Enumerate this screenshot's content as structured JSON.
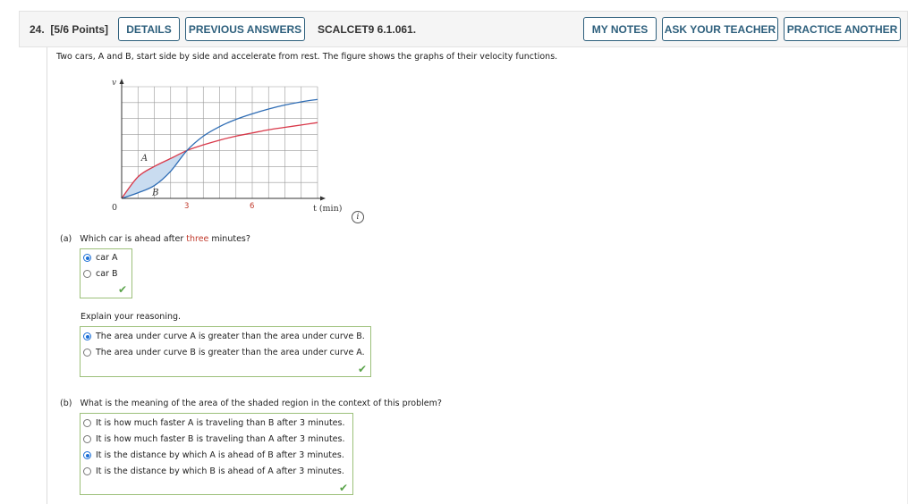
{
  "header": {
    "question_number": "24.",
    "points": "[5/6 Points]",
    "details_label": "DETAILS",
    "previous_answers_label": "PREVIOUS ANSWERS",
    "source": "SCALCET9 6.1.061.",
    "my_notes_label": "MY NOTES",
    "ask_teacher_label": "ASK YOUR TEACHER",
    "practice_another_label": "PRACTICE ANOTHER"
  },
  "intro": "Two cars, A and B, start side by side and accelerate from rest. The figure shows the graphs of their velocity functions.",
  "figure": {
    "info_icon": "i",
    "colors": {
      "curve_A": "#d9394a",
      "curve_B": "#2f6db5",
      "shade": "#c9dcf0",
      "tick_label": "#c0392b"
    }
  },
  "chart_data": {
    "type": "line",
    "title": "",
    "xlabel": "t (min)",
    "ylabel": "v",
    "origin_label": "0",
    "x_ticks": [
      3,
      6
    ],
    "xlim": [
      0,
      9
    ],
    "ylim": [
      0,
      7
    ],
    "grid": true,
    "grid_columns": 12,
    "grid_rows": 7,
    "series": [
      {
        "name": "A",
        "x": [
          0,
          0.75,
          1.5,
          2.25,
          3,
          3.75,
          4.5,
          5.25,
          6,
          6.75,
          7.5,
          8.25,
          9
        ],
        "y": [
          0,
          1.35,
          2.0,
          2.5,
          3.0,
          3.35,
          3.65,
          3.9,
          4.1,
          4.3,
          4.45,
          4.6,
          4.75
        ]
      },
      {
        "name": "B",
        "x": [
          0,
          0.75,
          1.5,
          2.25,
          3,
          3.75,
          4.5,
          5.25,
          6,
          6.75,
          7.5,
          8.25,
          9
        ],
        "y": [
          0,
          0.35,
          0.8,
          1.7,
          3.0,
          3.9,
          4.5,
          4.95,
          5.3,
          5.6,
          5.85,
          6.05,
          6.2
        ]
      }
    ],
    "annotations": [
      "A",
      "B"
    ],
    "shaded_region": "between A and B from t=0 to t=3"
  },
  "part_a": {
    "prefix": "(a)",
    "question_before": "Which car is ahead after ",
    "question_highlight": "three",
    "question_after": " minutes?",
    "options": [
      {
        "label": "car A",
        "selected": true
      },
      {
        "label": "car B",
        "selected": false
      }
    ],
    "correct": true,
    "explain_label": "Explain your reasoning.",
    "reason_options": [
      {
        "label": "The area under curve A is greater than the area under curve B.",
        "selected": true
      },
      {
        "label": "The area under curve B is greater than the area under curve A.",
        "selected": false
      }
    ],
    "reason_correct": true
  },
  "part_b": {
    "prefix": "(b)",
    "question": "What is the meaning of the area of the shaded region in the context of this problem?",
    "options": [
      {
        "label": "It is how much faster A is traveling than B after 3 minutes.",
        "selected": false
      },
      {
        "label": "It is how much faster B is traveling than A after 3 minutes.",
        "selected": false
      },
      {
        "label": "It is the distance by which A is ahead of B after 3 minutes.",
        "selected": true
      },
      {
        "label": "It is the distance by which B is ahead of A after 3 minutes.",
        "selected": false
      }
    ],
    "correct": true
  }
}
